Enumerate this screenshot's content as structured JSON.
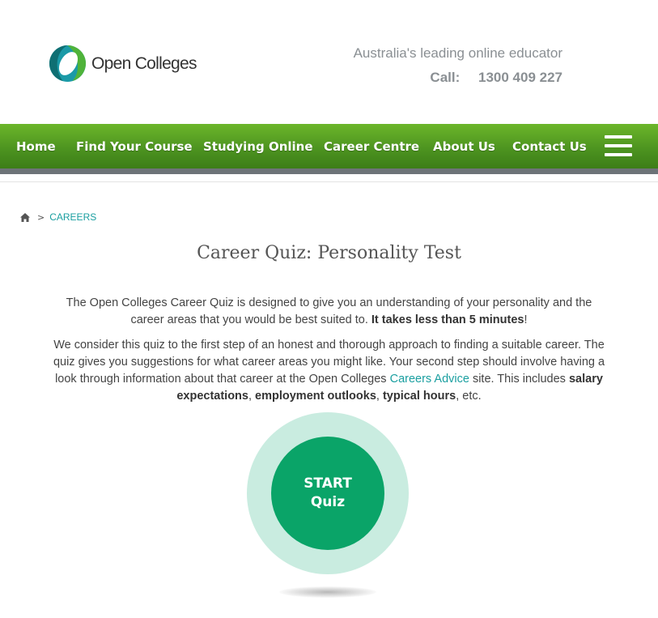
{
  "brand": {
    "name": "Open Colleges",
    "logo_colors": {
      "green": "#4fb33a",
      "teal": "#1b9aa7",
      "dark": "#0f6f73"
    }
  },
  "header": {
    "tagline": "Australia's leading online educator",
    "call_label": "Call:",
    "phone": "1300 409 227"
  },
  "nav": {
    "items": [
      {
        "label": "Home"
      },
      {
        "label": "Find Your Course"
      },
      {
        "label": "Studying Online"
      },
      {
        "label": "Career Centre"
      },
      {
        "label": "About Us"
      },
      {
        "label": "Contact Us"
      }
    ],
    "menu_icon": "hamburger-menu-icon"
  },
  "breadcrumb": {
    "home_icon": "home-icon",
    "separator": ">",
    "current": "CAREERS"
  },
  "page": {
    "title": "Career Quiz: Personality Test",
    "paragraph1": {
      "text": "The Open Colleges Career Quiz is designed to give you an understanding of your personality and the career areas that you would be best suited to. ",
      "bold": "It takes less than 5 minutes",
      "end": "!"
    },
    "paragraph2": {
      "text_before_link": "We consider this quiz to the first step of an honest and thorough approach to finding a suitable career. The quiz gives you suggestions for what career areas you might like. Your second step should involve having a look through information about that career at the Open Colleges ",
      "link": "Careers Advice",
      "text_after_link": " site. This includes ",
      "bold1": "salary expectations",
      "comma1": ", ",
      "bold2": "employment outlooks",
      "comma2": ", ",
      "bold3": "typical hours",
      "end": ", etc."
    }
  },
  "quiz_button": {
    "line1": "START",
    "line2": "Quiz"
  },
  "colors": {
    "nav_green": "#4d9420",
    "link_teal": "#1a9fa0",
    "button_green": "#0aa468",
    "button_ring": "#c9ece0"
  }
}
